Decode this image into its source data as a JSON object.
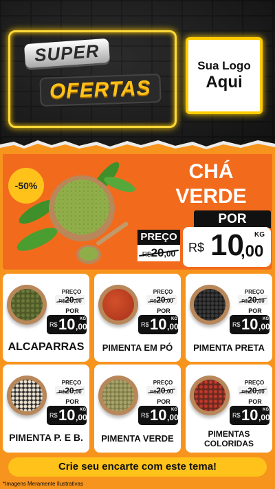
{
  "header": {
    "title_line1": "SUPER",
    "title_line2": "OFERTAS",
    "logo_line1": "Sua Logo",
    "logo_line2": "Aqui"
  },
  "hero": {
    "discount": "-50%",
    "name_line1": "CHÁ",
    "name_line2": "VERDE",
    "preco_label": "PREÇO",
    "old_currency": "R$",
    "old_int": "20",
    "old_cents": ",00",
    "por_label": "POR",
    "currency": "R$",
    "price_int": "10",
    "price_cents": ",00",
    "unit": "KG"
  },
  "products": [
    {
      "name": "ALCAPARRAS",
      "old_currency": "R$",
      "old_int": "20",
      "old_cents": ",00",
      "preco_label": "PREÇO",
      "por_label": "POR",
      "currency": "R$",
      "price_int": "10",
      "price_cents": ",00",
      "unit": "KG"
    },
    {
      "name": "PIMENTA EM PÓ",
      "old_currency": "R$",
      "old_int": "20",
      "old_cents": ",00",
      "preco_label": "PREÇO",
      "por_label": "POR",
      "currency": "R$",
      "price_int": "10",
      "price_cents": ",00",
      "unit": "KG"
    },
    {
      "name": "PIMENTA PRETA",
      "old_currency": "R$",
      "old_int": "20",
      "old_cents": ",00",
      "preco_label": "PREÇO",
      "por_label": "POR",
      "currency": "R$",
      "price_int": "10",
      "price_cents": ",00",
      "unit": "KG"
    },
    {
      "name": "PIMENTA P. E B.",
      "old_currency": "R$",
      "old_int": "20",
      "old_cents": ",00",
      "preco_label": "PREÇO",
      "por_label": "POR",
      "currency": "R$",
      "price_int": "10",
      "price_cents": ",00",
      "unit": "KG"
    },
    {
      "name": "PIMENTA VERDE",
      "old_currency": "R$",
      "old_int": "20",
      "old_cents": ",00",
      "preco_label": "PREÇO",
      "por_label": "POR",
      "currency": "R$",
      "price_int": "10",
      "price_cents": ",00",
      "unit": "KG"
    },
    {
      "name": "PIMENTAS COLORIDAS",
      "name_line1": "PIMENTAS",
      "name_line2": "COLORIDAS",
      "old_currency": "R$",
      "old_int": "20",
      "old_cents": ",00",
      "preco_label": "PREÇO",
      "por_label": "POR",
      "currency": "R$",
      "price_int": "10",
      "price_cents": ",00",
      "unit": "KG"
    }
  ],
  "cta": "Crie seu encarte com este tema!",
  "disclaimer": "*Imagens Meramente Ilustrativas",
  "colors": {
    "accent_orange": "#f7941d",
    "hero_orange": "#f26b1d",
    "yellow": "#ffc21a",
    "dark": "#111111"
  }
}
